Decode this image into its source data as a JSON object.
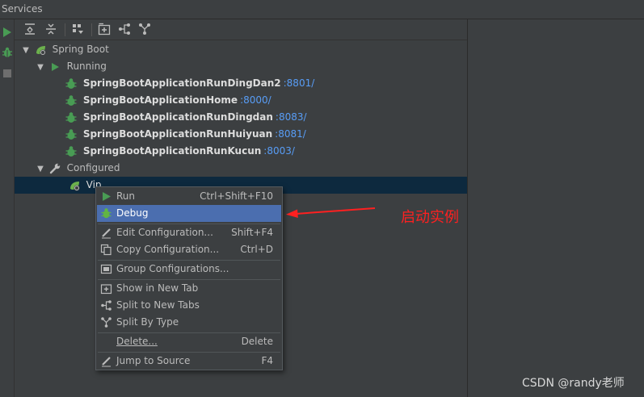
{
  "window": {
    "title": "Services"
  },
  "tree": {
    "root_label": "Spring Boot",
    "running_label": "Running",
    "running_apps": [
      {
        "name": "SpringBootApplicationRunDingDan2",
        "port": ":8801/"
      },
      {
        "name": "SpringBootApplicationHome",
        "port": ":8000/"
      },
      {
        "name": "SpringBootApplicationRunDingdan",
        "port": ":8083/"
      },
      {
        "name": "SpringBootApplicationRunHuiyuan",
        "port": ":8081/"
      },
      {
        "name": "SpringBootApplicationRunKucun",
        "port": ":8003/"
      }
    ],
    "configured_label": "Configured",
    "configured_item": "Vip"
  },
  "context_menu": {
    "items": [
      {
        "label": "Run",
        "shortcut": "Ctrl+Shift+F10",
        "icon": "run-icon"
      },
      {
        "label": "Debug",
        "shortcut": "",
        "icon": "debug-icon"
      },
      {
        "label": "Edit Configuration...",
        "shortcut": "Shift+F4",
        "icon": "edit-icon"
      },
      {
        "label": "Copy Configuration...",
        "shortcut": "Ctrl+D",
        "icon": "copy-icon"
      },
      {
        "label": "Group Configurations...",
        "shortcut": "",
        "icon": "group-icon"
      },
      {
        "label": "Show in New Tab",
        "shortcut": "",
        "icon": "new-tab-icon"
      },
      {
        "label": "Split to New Tabs",
        "shortcut": "",
        "icon": "split-icon"
      },
      {
        "label": "Split By Type",
        "shortcut": "",
        "icon": "split-type-icon"
      },
      {
        "label": "Delete...",
        "shortcut": "Delete",
        "icon": ""
      },
      {
        "label": "Jump to Source",
        "shortcut": "F4",
        "icon": "jump-icon"
      }
    ]
  },
  "annotation": {
    "text": "启动实例",
    "color": "#ff2020"
  },
  "watermark": "CSDN @randy老师",
  "colors": {
    "accent_highlight": "#4b6eaf",
    "port_link": "#589df6",
    "run_green": "#499c54",
    "selected_row": "#0d293e"
  }
}
